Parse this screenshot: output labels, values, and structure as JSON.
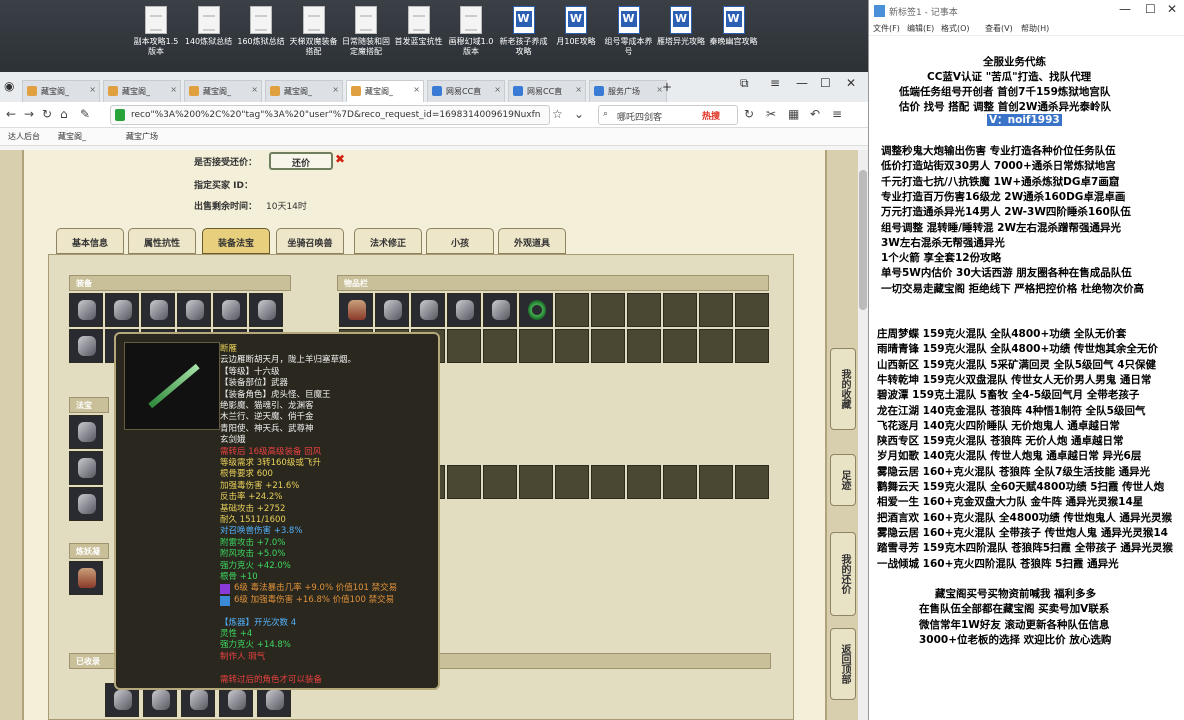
{
  "desktop": {
    "icons": [
      {
        "label": "副本攻略1.5版本",
        "type": "doc"
      },
      {
        "label": "140炼狱总结",
        "type": "doc"
      },
      {
        "label": "160炼狱总结",
        "type": "doc"
      },
      {
        "label": "天梯双魔装备搭配",
        "type": "doc"
      },
      {
        "label": "日常随装和固定魔搭配",
        "type": "doc"
      },
      {
        "label": "首发蓝宝抗性",
        "type": "doc"
      },
      {
        "label": "画穆幻域1.0版本",
        "type": "doc"
      },
      {
        "label": "新老孩子养成攻略",
        "type": "word"
      },
      {
        "label": "月10E攻略",
        "type": "word"
      },
      {
        "label": "组号零成本养号",
        "type": "word"
      },
      {
        "label": "雁塔异光攻略",
        "type": "word"
      },
      {
        "label": "秦晚幽宫攻略",
        "type": "word"
      }
    ]
  },
  "browser": {
    "tabs": [
      "藏宝阁_",
      "藏宝阁_",
      "藏宝阁_",
      "藏宝阁_",
      "藏宝阁_",
      "网易CC直",
      "网易CC直",
      "服务广场"
    ],
    "url": "reco\"%3A%200%2C%20\"tag\"%3A%20\"user\"%7D&reco_request_id=1698314009619Nuxfn",
    "search_placeholder": "哪吒四剑客",
    "hot_label": "热搜",
    "bookmarks": [
      "达人后台",
      "藏宝阁_",
      "藏宝广场"
    ]
  },
  "listing": {
    "counter_label": "是否接受还价：",
    "counter_button": "还价",
    "buyer_label": "指定买家 ID：",
    "buyer_value": "",
    "time_label": "出售剩余时间：",
    "time_value": "10天14时"
  },
  "game_tabs": [
    "基本信息",
    "属性抗性",
    "装备法宝",
    "坐骑召唤兽",
    "法术修正",
    "小孩",
    "外观道具"
  ],
  "sections": {
    "equip": "装备",
    "items": "物品栏",
    "fabao": "法宝",
    "tongjie": "炼妖凝",
    "collected": "已收录"
  },
  "tooltip": {
    "lines": [
      {
        "text": "断雁",
        "c": "y"
      },
      {
        "text": "云边雁断胡天月，陇上羊归塞草烟。",
        "c": "w"
      },
      {
        "text": "【等级】十六级",
        "c": "w"
      },
      {
        "text": "【装备部位】武器",
        "c": "w"
      },
      {
        "text": "【装备角色】虎头怪、巨魔王",
        "c": "w"
      },
      {
        "text": "绝影魔、猫魂引、龙渊客",
        "c": "w"
      },
      {
        "text": "木兰行、逆天魔、俏千金",
        "c": "w"
      },
      {
        "text": "青阳使、神天兵、武尊神",
        "c": "w"
      },
      {
        "text": "玄剑娥",
        "c": "w"
      },
      {
        "text": "需转后 16级高级装备 回风",
        "c": "r"
      },
      {
        "text": "等级需求 3转160级或飞升",
        "c": "y"
      },
      {
        "text": "根骨要求 600",
        "c": "y"
      },
      {
        "text": "加强毒伤害 +21.6%",
        "c": "y"
      },
      {
        "text": "反击率 +24.2%",
        "c": "y"
      },
      {
        "text": "基础攻击 +2752",
        "c": "y"
      },
      {
        "text": "耐久 1511/1600",
        "c": "y"
      },
      {
        "text": "对召唤兽伤害 +3.8%",
        "c": "b"
      },
      {
        "text": "附雷攻击 +7.0%",
        "c": "g"
      },
      {
        "text": "附风攻击 +5.0%",
        "c": "g"
      },
      {
        "text": "强力克火 +42.0%",
        "c": "g"
      },
      {
        "text": "根骨 +10",
        "c": "g"
      },
      {
        "text": "6级 毒法暴击几率 +9.0% 价值101 禁交易",
        "c": "o",
        "gem": "#8a3ad8"
      },
      {
        "text": "6级 加强毒伤害 +16.8% 价值100 禁交易",
        "c": "o",
        "gem": "#3a8ad8"
      },
      {
        "text": "",
        "c": "w"
      },
      {
        "text": "【炼器】开光次数 4",
        "c": "b"
      },
      {
        "text": "灵性 +4",
        "c": "g"
      },
      {
        "text": "强力克火 +14.8%",
        "c": "g"
      },
      {
        "text": "制作人 瑕气",
        "c": "r"
      },
      {
        "text": "",
        "c": "w"
      },
      {
        "text": "需转过后的角色才可以装备",
        "c": "r"
      }
    ]
  },
  "side_floats": [
    "我的收藏",
    "足迹",
    "我的还价",
    "返回顶部"
  ],
  "notepad": {
    "title": "新标签1 - 记事本",
    "menu": [
      "文件(F)",
      "编辑(E)",
      "格式(O)",
      "查看(V)",
      "帮助(H)"
    ],
    "header_lines": [
      "全服业务代练",
      "CC蓝V认证 \"苦瓜\"打造、找队代理",
      "低端任务组号开创者             首创7千159炼狱地宫队",
      "估价 找号 搭配 调整             首创2W通杀异光泰岭队"
    ],
    "highlight": "V：noif1993",
    "lines": [
      "调整秒鬼大炮输出伤害           专业打造各种价位任务队伍",
      "低价打造站街双30男人             7000+通杀日常炼狱地宫",
      "千元打造七抗/八抗铁魔           1W+通杀炼狱DG卓7画窟",
      "专业打造百万伤害16级龙           2W通杀160DG卓混卓画",
      "万元打造通杀异光14男人          2W-3W四阶睡杀160队伍",
      "组号调整 混转睡/睡转混          2W左右混杀蹭帮强通异光",
      "                                           3W左右混杀无帮强通异光",
      "1个火箭 享全套12份攻略",
      "单号5W内估价 30大话西游         朋友圈各种在售成品队伍",
      "一切交易走藏宝阁 拒绝线下      严格把控价格 杜绝物次价高"
    ],
    "list": [
      "庄周梦蝶 159克火混队 全队4800+功绩 全队无价套",
      "雨晴青锋 159克火混队 全队4800+功绩 传世炮其余全无价",
      "山西新区 159克火混队 5采矿满回灵 全队5级回气 4只保健",
      "牛转乾坤 159克火双盘混队 传世女人无价男人男鬼 通日常",
      "碧波潭    159克土混队 5畜牧 全4-5级回气月 全带老孩子",
      "龙在江湖 140克金混队 苍狼阵 4种悟1制符 全队5级回气",
      "飞花逐月 140克火四阶睡队 无价炮鬼人 通卓越日常",
      "陕西专区 159克火混队 苍狼阵 无价人炮 通卓越日常",
      "岁月如歌 140克火混队 传世人炮鬼 通卓越日常 异光6层",
      "雾隐云居 160+克火混队 苍狼阵 全队7级生活技能 通异光",
      "鹳舞云天 159克火混队 全60天赋4800功绩 5扫霞 传世人炮",
      "相爱一生 160+克金双盘大力队 金牛阵 通异光灵猴14星",
      "把酒言欢 160+克火混队 全4800功绩 传世炮鬼人 通异光灵猴",
      "雾隐云居 160+克火混队 全带孩子 传世炮人鬼 通异光灵猴14",
      "踏雪寻芳 159克木四阶混队 苍狼阵5扫霞 全带孩子 通异光灵猴",
      "一战倾城 160+克火四阶混队 苍狼阵 5扫霞 通异光"
    ],
    "footer": [
      "藏宝阁买号买物资前喊我 福利多多",
      "在售队伍全部都在藏宝阁 买卖号加V联系",
      "微信常年1W好友 滚动更新各种队伍信息",
      "3000+位老板的选择 欢迎比价 放心选购"
    ]
  }
}
